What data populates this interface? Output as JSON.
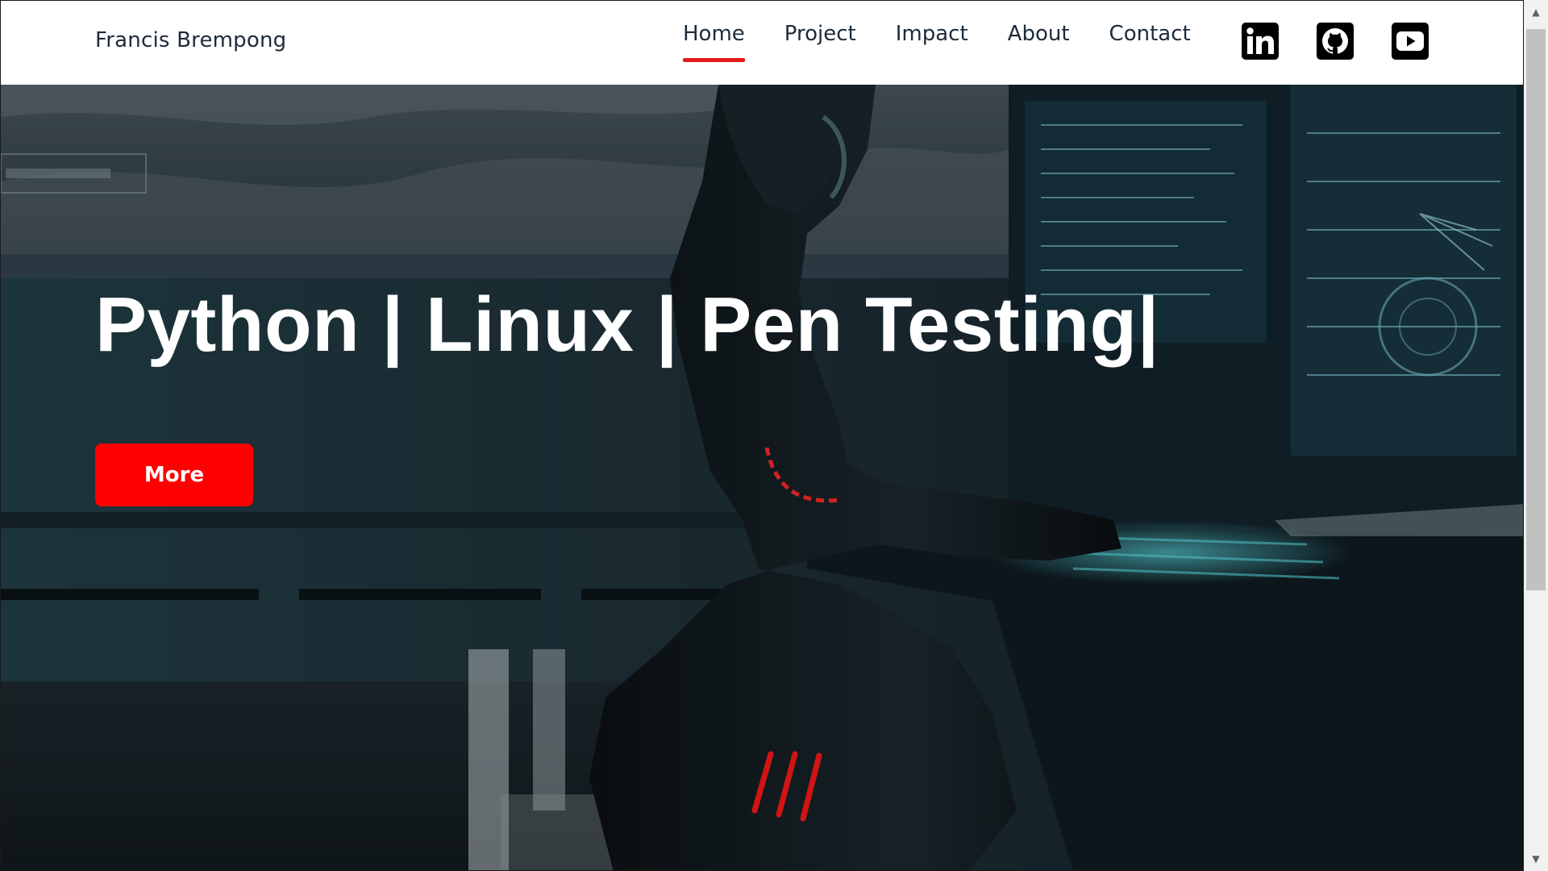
{
  "header": {
    "brand": "Francis Brempong",
    "nav": [
      {
        "label": "Home",
        "active": true
      },
      {
        "label": "Project",
        "active": false
      },
      {
        "label": "Impact",
        "active": false
      },
      {
        "label": "About",
        "active": false
      },
      {
        "label": "Contact",
        "active": false
      }
    ],
    "socials": [
      "linkedin-icon",
      "github-icon",
      "youtube-icon"
    ],
    "active_underline_color": "#e41b1b"
  },
  "hero": {
    "title": "Python | Linux | Pen Testing|",
    "button_label": "More",
    "button_color": "#ff0000"
  },
  "scrollbar": {
    "up_icon": "scroll-up-arrow-icon",
    "down_icon": "scroll-down-arrow-icon"
  }
}
